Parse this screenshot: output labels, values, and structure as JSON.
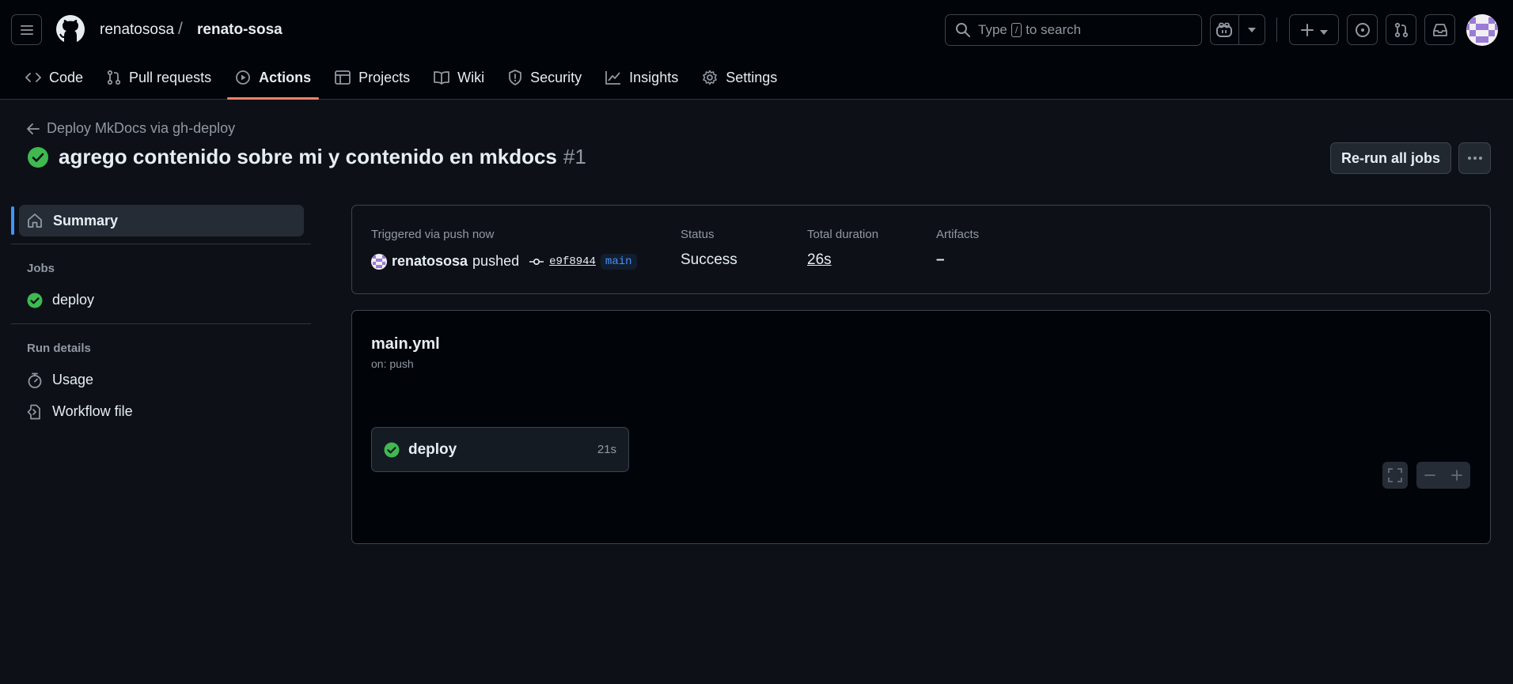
{
  "header": {
    "owner": "renatososa",
    "separator": "/",
    "repo": "renato-sosa",
    "search": {
      "prefix": "Type",
      "key": "/",
      "suffix": "to search"
    }
  },
  "tabs": [
    {
      "label": "Code",
      "icon": "code-icon"
    },
    {
      "label": "Pull requests",
      "icon": "pull-request-icon"
    },
    {
      "label": "Actions",
      "icon": "play-icon",
      "active": true
    },
    {
      "label": "Projects",
      "icon": "table-icon"
    },
    {
      "label": "Wiki",
      "icon": "book-icon"
    },
    {
      "label": "Security",
      "icon": "shield-icon"
    },
    {
      "label": "Insights",
      "icon": "graph-icon"
    },
    {
      "label": "Settings",
      "icon": "gear-icon"
    }
  ],
  "run": {
    "back_label": "Deploy MkDocs via gh-deploy",
    "title": "agrego contenido sobre mi y contenido en mkdocs",
    "number": "#1",
    "rerun_label": "Re-run all jobs"
  },
  "sidebar": {
    "summary_label": "Summary",
    "jobs_heading": "Jobs",
    "jobs": [
      {
        "label": "deploy"
      }
    ],
    "run_details_heading": "Run details",
    "details": [
      {
        "label": "Usage",
        "icon": "stopwatch-icon"
      },
      {
        "label": "Workflow file",
        "icon": "file-code-icon"
      }
    ]
  },
  "summary": {
    "trigger_label": "Triggered via push now",
    "user": "renatososa",
    "action": "pushed",
    "commit": "e9f8944",
    "branch": "main",
    "status_label": "Status",
    "status_value": "Success",
    "duration_label": "Total duration",
    "duration_value": "26s",
    "artifacts_label": "Artifacts",
    "artifacts_value": "–"
  },
  "workflow": {
    "file": "main.yml",
    "trigger": "on: push",
    "job": {
      "name": "deploy",
      "time": "21s"
    }
  },
  "colors": {
    "success": "#3fb950",
    "accent_tab": "#f78166",
    "link_blue": "#4493f8"
  }
}
